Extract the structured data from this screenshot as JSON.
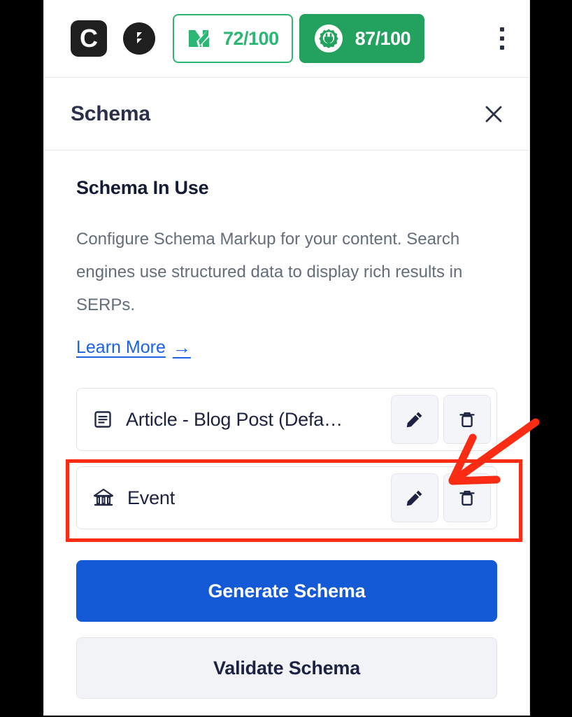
{
  "toolbar": {
    "brand_icon_c": "clearscope-c-icon",
    "brand_icon_b": "bloggle-b-icon",
    "c_letter": "C",
    "scores": [
      {
        "icon": "rankmath-logo-icon",
        "value": "72/100",
        "style": "outline",
        "color": "#2bb673"
      },
      {
        "icon": "gear-plug-icon",
        "value": "87/100",
        "style": "solid",
        "color": "#22a15f"
      }
    ],
    "more_menu": "kebab-menu-icon"
  },
  "header": {
    "title": "Schema",
    "close_label": "close-icon"
  },
  "main": {
    "section_title": "Schema In Use",
    "description": "Configure Schema Markup for your content. Search engines use structured data to display rich results in SERPs.",
    "learn_more": "Learn More",
    "learn_more_arrow": "→"
  },
  "schema_list": [
    {
      "icon": "document-lines-icon",
      "label": "Article - Blog Post (Defa…",
      "edit_label": "pencil-icon",
      "delete_label": "trash-icon",
      "highlighted": false
    },
    {
      "icon": "pavilion-icon",
      "label": "Event",
      "edit_label": "pencil-icon",
      "delete_label": "trash-icon",
      "highlighted": true
    }
  ],
  "actions": {
    "generate": "Generate Schema",
    "validate": "Validate Schema",
    "primary_color": "#1459d6"
  },
  "annotations": {
    "highlight_color": "#fa2d14",
    "highlight_target": "event-row",
    "arrow_target": "event-edit-button"
  }
}
